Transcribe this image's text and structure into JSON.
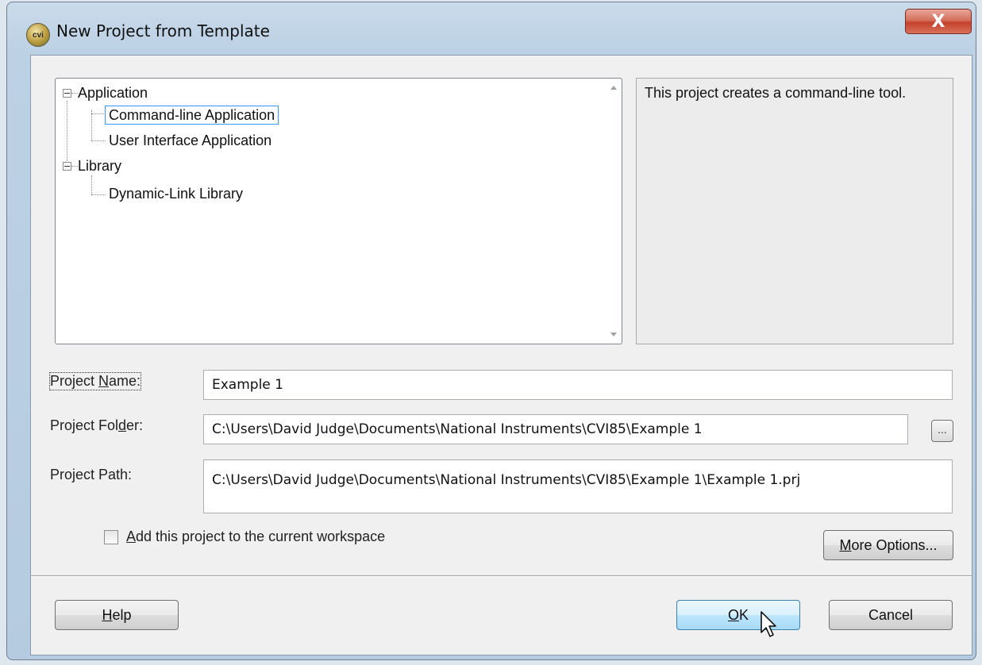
{
  "window": {
    "title": "New Project from Template",
    "close_glyph": "X",
    "icon_text": "cvi"
  },
  "tree": {
    "groups": [
      {
        "label": "Application",
        "children": [
          "Command-line Application",
          "User Interface Application"
        ]
      },
      {
        "label": "Library",
        "children": [
          "Dynamic-Link Library"
        ]
      }
    ],
    "selected": "Command-line Application"
  },
  "description": "This project creates a command-line tool.",
  "form": {
    "name_label": {
      "pre": "Project ",
      "key": "N",
      "post": "ame:"
    },
    "name_value": "Example 1",
    "folder_label": {
      "pre": "Project Fol",
      "key": "d",
      "post": "er:"
    },
    "folder_value": "C:\\Users\\David Judge\\Documents\\National Instruments\\CVI85\\Example 1",
    "browse_label": "...",
    "path_label": "Project Path:",
    "path_value": "C:\\Users\\David Judge\\Documents\\National Instruments\\CVI85\\Example 1\\Example 1.prj",
    "add_checkbox": {
      "key": "A",
      "post": "dd this project to the current workspace",
      "checked": false
    }
  },
  "buttons": {
    "more_options": {
      "key": "M",
      "post": "ore Options..."
    },
    "help": {
      "key": "H",
      "post": "elp"
    },
    "ok": {
      "key": "O",
      "post": "K"
    },
    "cancel": "Cancel"
  },
  "colors": {
    "selection_border": "#3399ff",
    "close_button": "#c3422d",
    "default_button_border": "#3c7fb1"
  }
}
